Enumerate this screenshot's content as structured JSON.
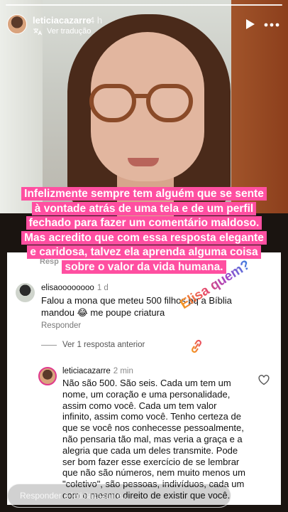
{
  "header": {
    "username": "leticiacazarre",
    "time_ago": "4 h",
    "translate_label": "Ver tradução",
    "icons": [
      "translate-icon",
      "play-icon",
      "more-icon"
    ]
  },
  "caption": {
    "lines": [
      "Infelizmente sempre tem alguém que se sente",
      "à vontade atrás de uma tela e de um perfil",
      "fechado para fazer um comentário maldoso.",
      "Mas acredito que com essa resposta elegante",
      "e caridosa, talvez ela aprenda alguma coisa",
      "sobre o valor da vida humana."
    ],
    "color": "#ff4fa1"
  },
  "hidden_reply_label": "Resp",
  "comment1": {
    "username": "elisaoooooooo",
    "age": "1 d",
    "text": "Falou a mona que meteu 500 filhos pq a Bíblia mandou 😂 me poupe criatura",
    "reply_label": "Responder"
  },
  "more_replies_label": "Ver 1 resposta anterior",
  "sticker": {
    "text": "Elisa quem?",
    "icon": "link-icon"
  },
  "comment2": {
    "username": "leticiacazarre",
    "age": "2 min",
    "text": "Não são 500. São seis. Cada um tem um nome, um coração e uma personalidade, assim como você. Cada um tem valor infinito, assim como você. Tenho certeza de que se você nos conhecesse pessoalmente, não pensaria tão mal, mas veria a graça e a alegria que cada um deles transmite. Pode ser bom fazer esse exercício de se lembrar que não são números, nem muito menos um \"coletivo\", são pessoas, indivíduos, cada um com o mesmo direito de existir que você."
  },
  "footer": {
    "reply_placeholder": "Responder a leticiacazarre...",
    "icons": [
      "heart-icon",
      "send-icon"
    ]
  }
}
